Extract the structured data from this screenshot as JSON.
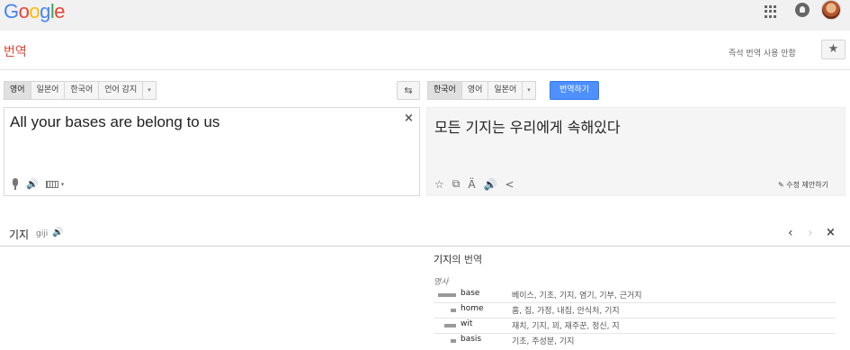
{
  "header": {
    "logo_letters": [
      {
        "char": "G",
        "color": "#4285f4"
      },
      {
        "char": "o",
        "color": "#ea4335"
      },
      {
        "char": "o",
        "color": "#fbbc05"
      },
      {
        "char": "g",
        "color": "#4285f4"
      },
      {
        "char": "l",
        "color": "#34a853"
      },
      {
        "char": "e",
        "color": "#ea4335"
      }
    ],
    "icons": [
      "apps-icon",
      "notifications-icon",
      "avatar"
    ]
  },
  "title_row": {
    "title": "번역",
    "instant_translation_link": "즉석 번역 사용 안함",
    "star_icon": "★"
  },
  "source": {
    "languages": [
      "영어",
      "일본어",
      "한국어",
      "언어 감지"
    ],
    "selected": "영어",
    "caret": "▾",
    "text": "All your bases are belong to us",
    "clear_icon": "×",
    "speaker_icon": "🔊",
    "keyboard_caret": "▾"
  },
  "swap_icon": "⇆",
  "target": {
    "languages": [
      "한국어",
      "영어",
      "일본어"
    ],
    "selected": "한국어",
    "caret": "▾",
    "translate_button": "번역하기",
    "text": "모든 기지는 우리에게 속해있다",
    "tool_icons": [
      "☆",
      "⧉",
      "Ä",
      "🔊",
      "<"
    ],
    "suggest_edit": "✎ 수정 제안하기"
  },
  "dictionary": {
    "word": "기지",
    "romanization": "giji",
    "speaker_icon": "🔊",
    "nav_prev": "‹",
    "nav_next": "›",
    "close": "×",
    "heading_word": "기지",
    "heading_suffix": "의 번역",
    "part_of_speech": "명사",
    "entries": [
      {
        "term": "base",
        "synonyms": "베이스, 기초, 기지, 염기, 기부, 근거지",
        "frequency": 1.0
      },
      {
        "term": "home",
        "synonyms": "홈, 집, 가정, 내집, 안식처, 기지",
        "frequency": 0.3
      },
      {
        "term": "wit",
        "synonyms": "재치, 기지, 꾀, 재주꾼, 정신, 지",
        "frequency": 0.65
      },
      {
        "term": "basis",
        "synonyms": "기초, 주성분, 기지",
        "frequency": 0.3
      }
    ]
  }
}
